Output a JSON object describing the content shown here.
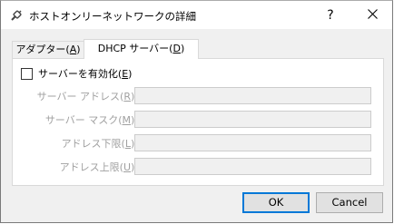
{
  "window": {
    "title": "ホストオンリーネットワークの詳細",
    "help_glyph": "?",
    "close_glyph": "✕"
  },
  "tabs": [
    {
      "label": "アダプター(",
      "mnemonic": "A",
      "suffix": ")",
      "selected": false
    },
    {
      "label": "DHCP サーバー(",
      "mnemonic": "D",
      "suffix": ")",
      "selected": true
    }
  ],
  "dhcp": {
    "enable_label": "サーバーを有効化(",
    "enable_mnemonic": "E",
    "enable_suffix": ")",
    "enable_checked": false,
    "fields": [
      {
        "label": "サーバー アドレス(",
        "mnemonic": "R",
        "suffix": "):",
        "value": ""
      },
      {
        "label": "サーバー マスク(",
        "mnemonic": "M",
        "suffix": "):",
        "value": ""
      },
      {
        "label": "アドレス下限(",
        "mnemonic": "L",
        "suffix": "):",
        "value": ""
      },
      {
        "label": "アドレス上限(",
        "mnemonic": "U",
        "suffix": "):",
        "value": ""
      }
    ]
  },
  "buttons": {
    "ok": "OK",
    "cancel": "Cancel"
  }
}
